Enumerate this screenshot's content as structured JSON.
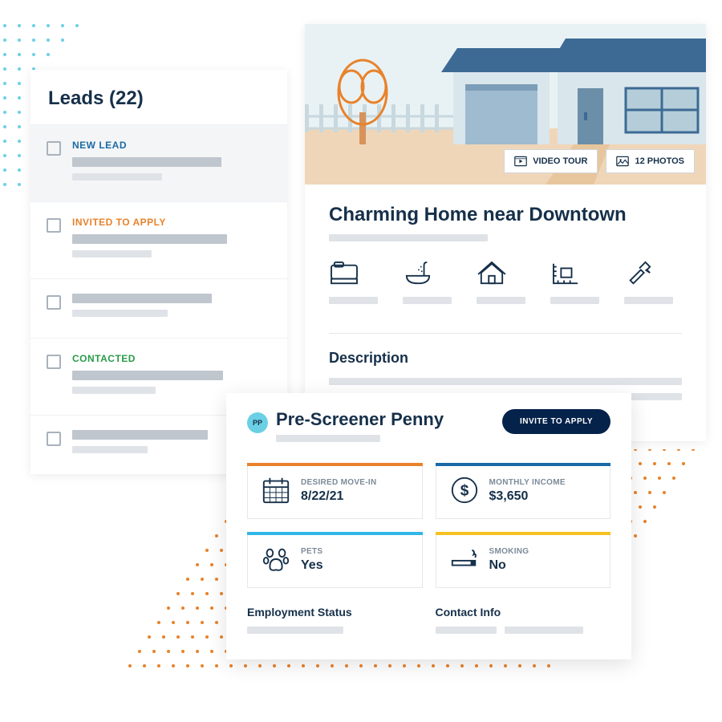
{
  "colors": {
    "dot_blue": "#6bd0e6",
    "dot_orange": "#e8822b"
  },
  "leads": {
    "title": "Leads (22)",
    "statuses": {
      "new": "NEW LEAD",
      "invited": "INVITED TO APPLY",
      "contacted": "CONTACTED"
    }
  },
  "listing": {
    "title": "Charming Home near Downtown",
    "video_tour": "VIDEO TOUR",
    "photos": "12 PHOTOS",
    "description_label": "Description"
  },
  "lead_card": {
    "avatar_initials": "PP",
    "name": "Pre-Screener Penny",
    "invite_button": "INVITE TO APPLY",
    "boxes": {
      "move_in": {
        "label": "DESIRED MOVE-IN",
        "value": "8/22/21"
      },
      "income": {
        "label": "MONTHLY INCOME",
        "value": "$3,650"
      },
      "pets": {
        "label": "PETS",
        "value": "Yes"
      },
      "smoking": {
        "label": "SMOKING",
        "value": "No"
      }
    },
    "employment_label": "Employment Status",
    "contact_label": "Contact Info"
  }
}
